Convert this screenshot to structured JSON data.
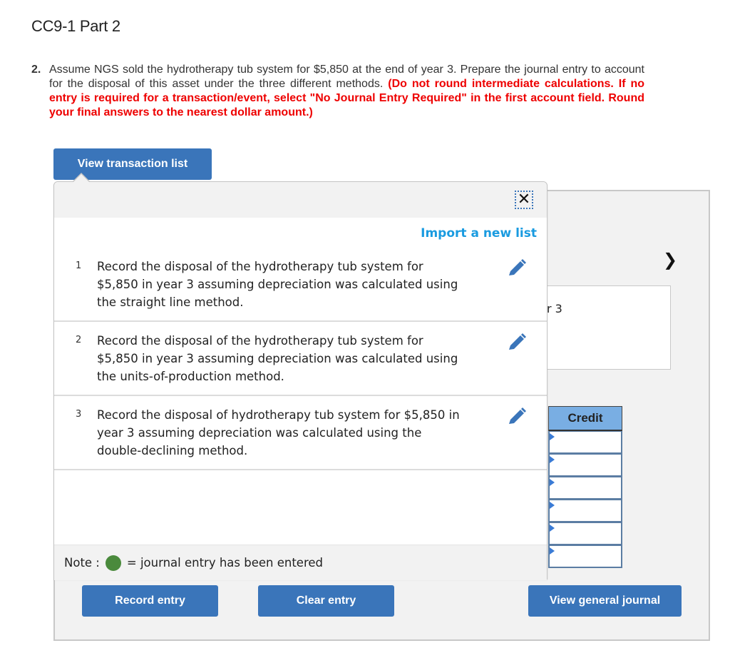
{
  "page": {
    "title": "CC9-1 Part 2"
  },
  "question": {
    "number": "2.",
    "text": "Assume NGS sold the hydrotherapy tub system for $5,850 at the end of year 3. Prepare the journal entry to account for the disposal of this asset under the three different methods.",
    "instruction": "(Do not round intermediate calculations. If no entry is required for a transaction/event, select \"No Journal Entry Required\" in the first account field. Round your final answers to the nearest dollar amount.)"
  },
  "popup": {
    "toggle_label": "View transaction list",
    "close_icon": "close-icon",
    "import_link": "Import a new list",
    "transactions": [
      {
        "number": "1",
        "text": "Record the disposal of the hydrotherapy tub system for $5,850 in year 3 assuming depreciation was calculated using the straight line method.",
        "icon": "pencil-icon"
      },
      {
        "number": "2",
        "text": "Record the disposal of the hydrotherapy tub system for $5,850 in year 3 assuming depreciation was calculated using the units-of-production method.",
        "icon": "pencil-icon"
      },
      {
        "number": "3",
        "text": "Record the disposal of hydrotherapy tub system for $5,850 in year 3 assuming depreciation was calculated using the double-declining method.",
        "icon": "pencil-icon"
      }
    ],
    "note": {
      "prefix": "Note :",
      "legend": "= journal entry has been entered",
      "dot_color": "#4a8a3c"
    }
  },
  "journal": {
    "next_icon": "chevron-right-icon",
    "description_partial": "r 3",
    "credit_header": "Credit",
    "credit_values": [
      "",
      "",
      "",
      "",
      "",
      ""
    ]
  },
  "buttons": {
    "record": "Record entry",
    "clear": "Clear entry",
    "view_journal": "View general journal"
  },
  "colors": {
    "button_blue": "#3a75ba",
    "link_blue": "#1a9be0",
    "warning_red": "#ee0000",
    "header_blue": "#79aee3"
  }
}
